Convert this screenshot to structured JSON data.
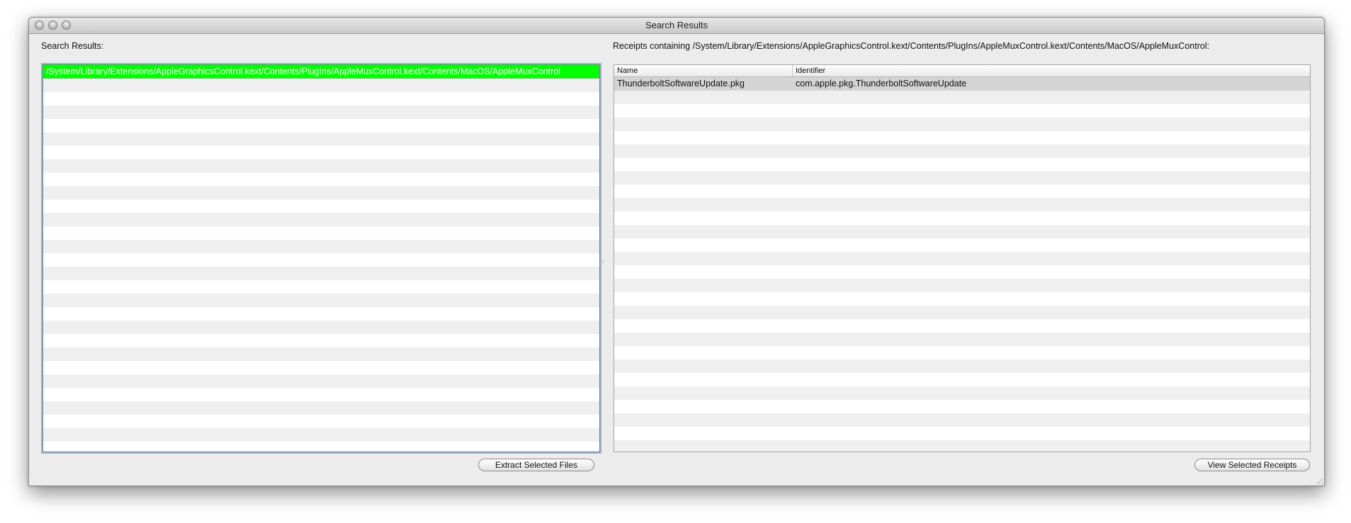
{
  "window": {
    "title": "Search Results"
  },
  "left_panel": {
    "label": "Search Results:",
    "items": [
      "/System/Library/Extensions/AppleGraphicsControl.kext/Contents/PlugIns/AppleMuxControl.kext/Contents/MacOS/AppleMuxControl"
    ],
    "selected_index": 0,
    "selection_color": "#00ff00",
    "button_label": "Extract Selected Files"
  },
  "right_panel": {
    "label": "Receipts containing /System/Library/Extensions/AppleGraphicsControl.kext/Contents/PlugIns/AppleMuxControl.kext/Contents/MacOS/AppleMuxControl:",
    "columns": [
      "Name",
      "Identifier"
    ],
    "rows": [
      {
        "name": "ThunderboltSoftwareUpdate.pkg",
        "identifier": "com.apple.pkg.ThunderboltSoftwareUpdate"
      }
    ],
    "button_label": "View Selected Receipts"
  }
}
